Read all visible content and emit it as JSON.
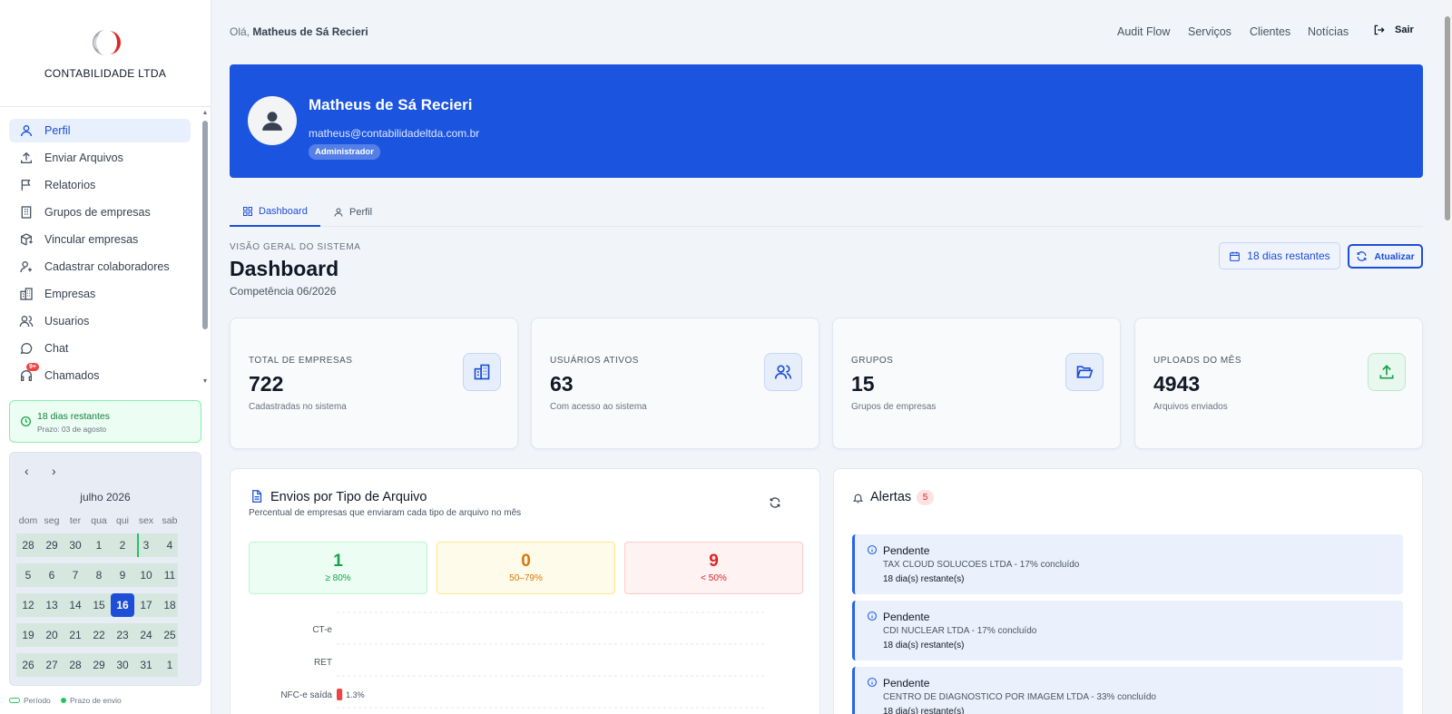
{
  "company": "CONTABILIDADE LTDA",
  "sidebar": {
    "items": [
      {
        "label": "Perfil",
        "icon": "user-icon"
      },
      {
        "label": "Enviar Arquivos",
        "icon": "upload-icon"
      },
      {
        "label": "Relatorios",
        "icon": "flag-icon"
      },
      {
        "label": "Grupos de empresas",
        "icon": "building-icon"
      },
      {
        "label": "Vincular empresas",
        "icon": "package-link-icon"
      },
      {
        "label": "Cadastrar colaboradores",
        "icon": "user-plus-icon"
      },
      {
        "label": "Empresas",
        "icon": "buildings-icon"
      },
      {
        "label": "Usuarios",
        "icon": "users-icon"
      },
      {
        "label": "Chat",
        "icon": "chat-icon"
      },
      {
        "label": "Chamados",
        "icon": "headset-icon",
        "badge": "9+"
      }
    ],
    "deadline": {
      "title": "18 dias restantes",
      "subtitle": "Prazo: 03 de agosto"
    },
    "calendar": {
      "month": "julho 2026",
      "weekdays": [
        "dom",
        "seg",
        "ter",
        "qua",
        "qui",
        "sex",
        "sab"
      ],
      "weeks": [
        [
          "28",
          "29",
          "30",
          "1",
          "2",
          "3",
          "4"
        ],
        [
          "5",
          "6",
          "7",
          "8",
          "9",
          "10",
          "11"
        ],
        [
          "12",
          "13",
          "14",
          "15",
          "16",
          "17",
          "18"
        ],
        [
          "19",
          "20",
          "21",
          "22",
          "23",
          "24",
          "25"
        ],
        [
          "26",
          "27",
          "28",
          "29",
          "30",
          "31",
          "1"
        ]
      ],
      "today": "16"
    },
    "legend": {
      "period": "Período",
      "deadline": "Prazo de envio"
    }
  },
  "header": {
    "greeting_prefix": "Olá,",
    "user_name": "Matheus de Sá Recieri",
    "links": [
      "Audit Flow",
      "Serviços",
      "Clientes",
      "Notícias"
    ],
    "logout": "Sair"
  },
  "profile": {
    "name": "Matheus de Sá Recieri",
    "email": "matheus@contabilidadeltda.com.br",
    "role": "Administrador"
  },
  "tabs": [
    "Dashboard",
    "Perfil"
  ],
  "dashboard": {
    "overline": "VISÃO GERAL DO SISTEMA",
    "title": "Dashboard",
    "competencia": "Competência 06/2026",
    "days_button": "18 dias restantes",
    "update_button": "Atualizar"
  },
  "stats": [
    {
      "label": "TOTAL DE EMPRESAS",
      "value": "722",
      "sub": "Cadastradas no sistema",
      "icon": "building-icon"
    },
    {
      "label": "USUÁRIOS ATIVOS",
      "value": "63",
      "sub": "Com acesso ao sistema",
      "icon": "users-icon"
    },
    {
      "label": "GRUPOS",
      "value": "15",
      "sub": "Grupos de empresas",
      "icon": "folder-open-icon"
    },
    {
      "label": "UPLOADS DO MÊS",
      "value": "4943",
      "sub": "Arquivos enviados",
      "icon": "upload-icon"
    }
  ],
  "envios": {
    "title": "Envios por Tipo de Arquivo",
    "subtitle": "Percentual de empresas que enviaram cada tipo de arquivo no mês",
    "buckets": [
      {
        "count": "1",
        "range": "≥ 80%"
      },
      {
        "count": "0",
        "range": "50–79%"
      },
      {
        "count": "9",
        "range": "< 50%"
      }
    ]
  },
  "chart_data": {
    "type": "bar",
    "orientation": "horizontal",
    "categories": [
      "CT-e",
      "RET",
      "NFC-e saída"
    ],
    "values": [
      null,
      null,
      1.3
    ],
    "value_labels": [
      "",
      "",
      "1.3%"
    ],
    "bar_color": "#ef4444",
    "grid": true
  },
  "alerts": {
    "title": "Alertas",
    "count": "5",
    "items": [
      {
        "status": "Pendente",
        "desc": "TAX CLOUD SOLUCOES LTDA - 17% concluído",
        "remaining": "18 dia(s) restante(s)"
      },
      {
        "status": "Pendente",
        "desc": "CDI NUCLEAR LTDA - 17% concluído",
        "remaining": "18 dia(s) restante(s)"
      },
      {
        "status": "Pendente",
        "desc": "CENTRO DE DIAGNOSTICO POR IMAGEM LTDA - 33% concluído",
        "remaining": "18 dia(s) restante(s)"
      }
    ]
  }
}
